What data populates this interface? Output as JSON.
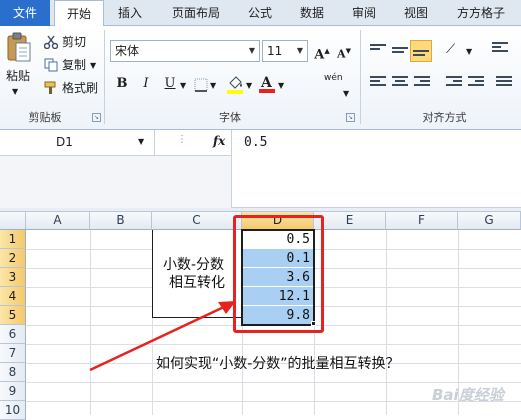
{
  "tabs": [
    "文件",
    "开始",
    "插入",
    "页面布局",
    "公式",
    "数据",
    "审阅",
    "视图",
    "方方格子"
  ],
  "clipboard": {
    "paste_label": "粘贴",
    "cut_label": "剪切",
    "copy_label": "复制",
    "format_painter_label": "格式刷",
    "group_label": "剪贴板"
  },
  "font": {
    "name": "宋体",
    "size": "11",
    "bold": "B",
    "italic": "I",
    "underline": "U",
    "grow": "A",
    "shrink": "A",
    "wen": "wén",
    "group_label": "字体"
  },
  "alignment": {
    "group_label": "对齐方式"
  },
  "formula_bar": {
    "name_box": "D1",
    "fx": "fx",
    "value": "0.5"
  },
  "columns": [
    "A",
    "B",
    "C",
    "D",
    "E",
    "F",
    "G"
  ],
  "rows": [
    "1",
    "2",
    "3",
    "4",
    "5",
    "6",
    "7",
    "8",
    "9",
    "10"
  ],
  "cells": {
    "d_values": [
      "0.5",
      "0.1",
      "3.6",
      "12.1",
      "9.8"
    ],
    "c_label_line1": "小数-分数",
    "c_label_line2": "相互转化",
    "question": "如何实现“小数-分数”的批量相互转换？"
  },
  "watermark": "Bai度经验",
  "colors": {
    "file_tab": "#2a6fcb",
    "selection_fill": "#a9d0f2",
    "header_selected": "#f5c96a",
    "annotation_red": "#e8231f"
  }
}
